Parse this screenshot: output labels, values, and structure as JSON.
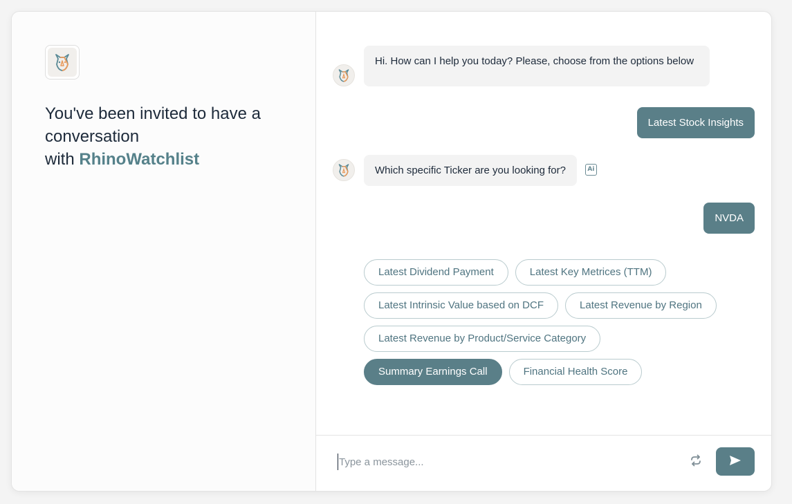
{
  "left": {
    "invite_line1": "You've been invited to have a conversation",
    "invite_line2_prefix": "with ",
    "brand": "RhinoWatchlist"
  },
  "messages": [
    {
      "from": "bot",
      "text": "Hi. How can I help you today? Please, choose from the options below"
    },
    {
      "from": "user",
      "text": "Latest Stock Insights"
    },
    {
      "from": "bot",
      "text": "Which specific Ticker are you looking for?",
      "badge": "Ai"
    },
    {
      "from": "user",
      "text": "NVDA"
    }
  ],
  "options": [
    {
      "label": "Latest Dividend Payment",
      "selected": false
    },
    {
      "label": "Latest Key Metrices (TTM)",
      "selected": false
    },
    {
      "label": "Latest Intrinsic Value based on DCF",
      "selected": false
    },
    {
      "label": "Latest Revenue by Region",
      "selected": false
    },
    {
      "label": "Latest Revenue by Product/Service Category",
      "selected": false
    },
    {
      "label": "Summary Earnings Call",
      "selected": true
    },
    {
      "label": "Financial Health Score",
      "selected": false
    }
  ],
  "composer": {
    "placeholder": "Type a message...",
    "value": ""
  },
  "icons": {
    "logo": "rhino-logo-icon",
    "avatar": "rhino-avatar-icon",
    "ai_badge": "ai-icon",
    "refresh": "refresh-icon",
    "send": "send-icon"
  },
  "colors": {
    "accent": "#5a7f88",
    "chip_border": "#b9cbce",
    "bot_bubble": "#f3f3f3",
    "logo_orange": "#e99a5b",
    "logo_teal": "#5a8a96"
  }
}
